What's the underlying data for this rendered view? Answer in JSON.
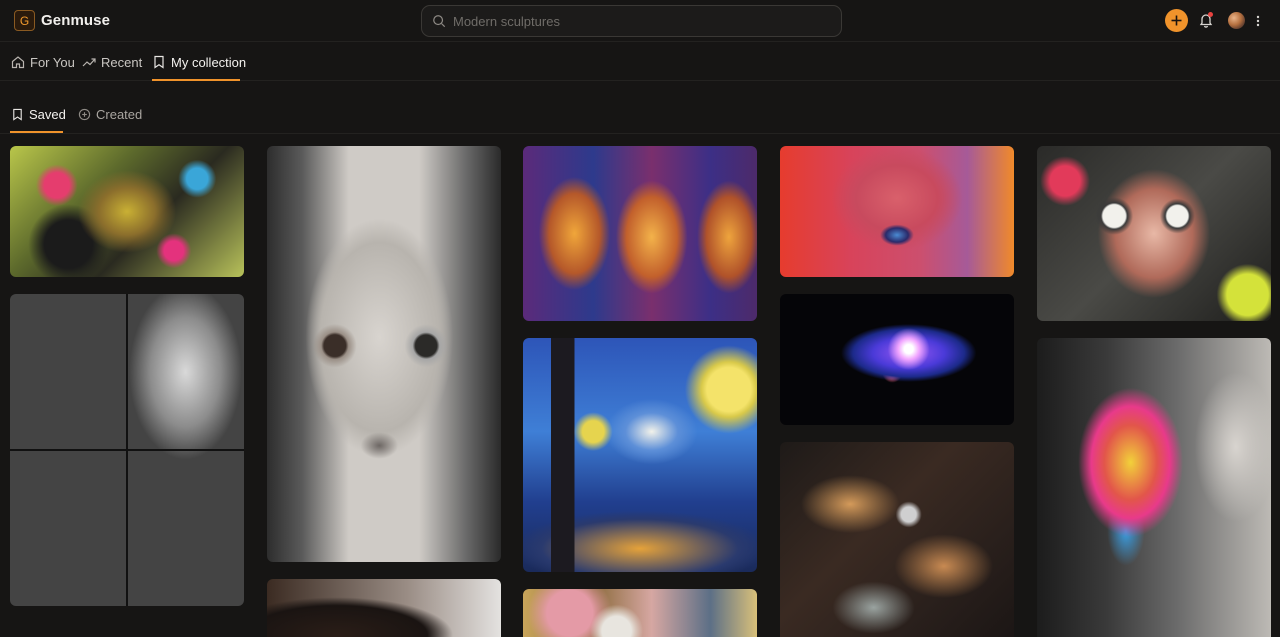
{
  "app": {
    "logo_letter": "G",
    "name": "Genmuse"
  },
  "search": {
    "placeholder": "Modern sculptures",
    "value": ""
  },
  "header_icons": [
    "search-icon",
    "plus-icon",
    "bell-icon",
    "avatar",
    "more-vertical-icon"
  ],
  "nav": {
    "tabs": [
      {
        "label": "For You",
        "icon": "home-icon"
      },
      {
        "label": "Recent",
        "icon": "trending-icon"
      },
      {
        "label": "My collection",
        "icon": "bookmark-icon",
        "active": true
      }
    ]
  },
  "collection": {
    "tabs": [
      {
        "label": "Saved",
        "icon": "bookmark-icon",
        "active": true
      },
      {
        "label": "Created",
        "icon": "plus-circle-icon"
      }
    ]
  },
  "colors": {
    "accent": "#f0932b",
    "background": "#161514",
    "notification": "#e8423f"
  },
  "gallery": [
    "mixed-media-face-collage",
    "ear-sketches-grid",
    "monochrome-portrait-dripping",
    "portrait-partial",
    "triple-profile-painting",
    "starry-night-style-painting",
    "colorful-abstract-partial",
    "pixelated-pink-face",
    "glowing-blue-flower",
    "swirling-abstract-lines",
    "collage-face-with-eyes",
    "painted-man-profile"
  ]
}
